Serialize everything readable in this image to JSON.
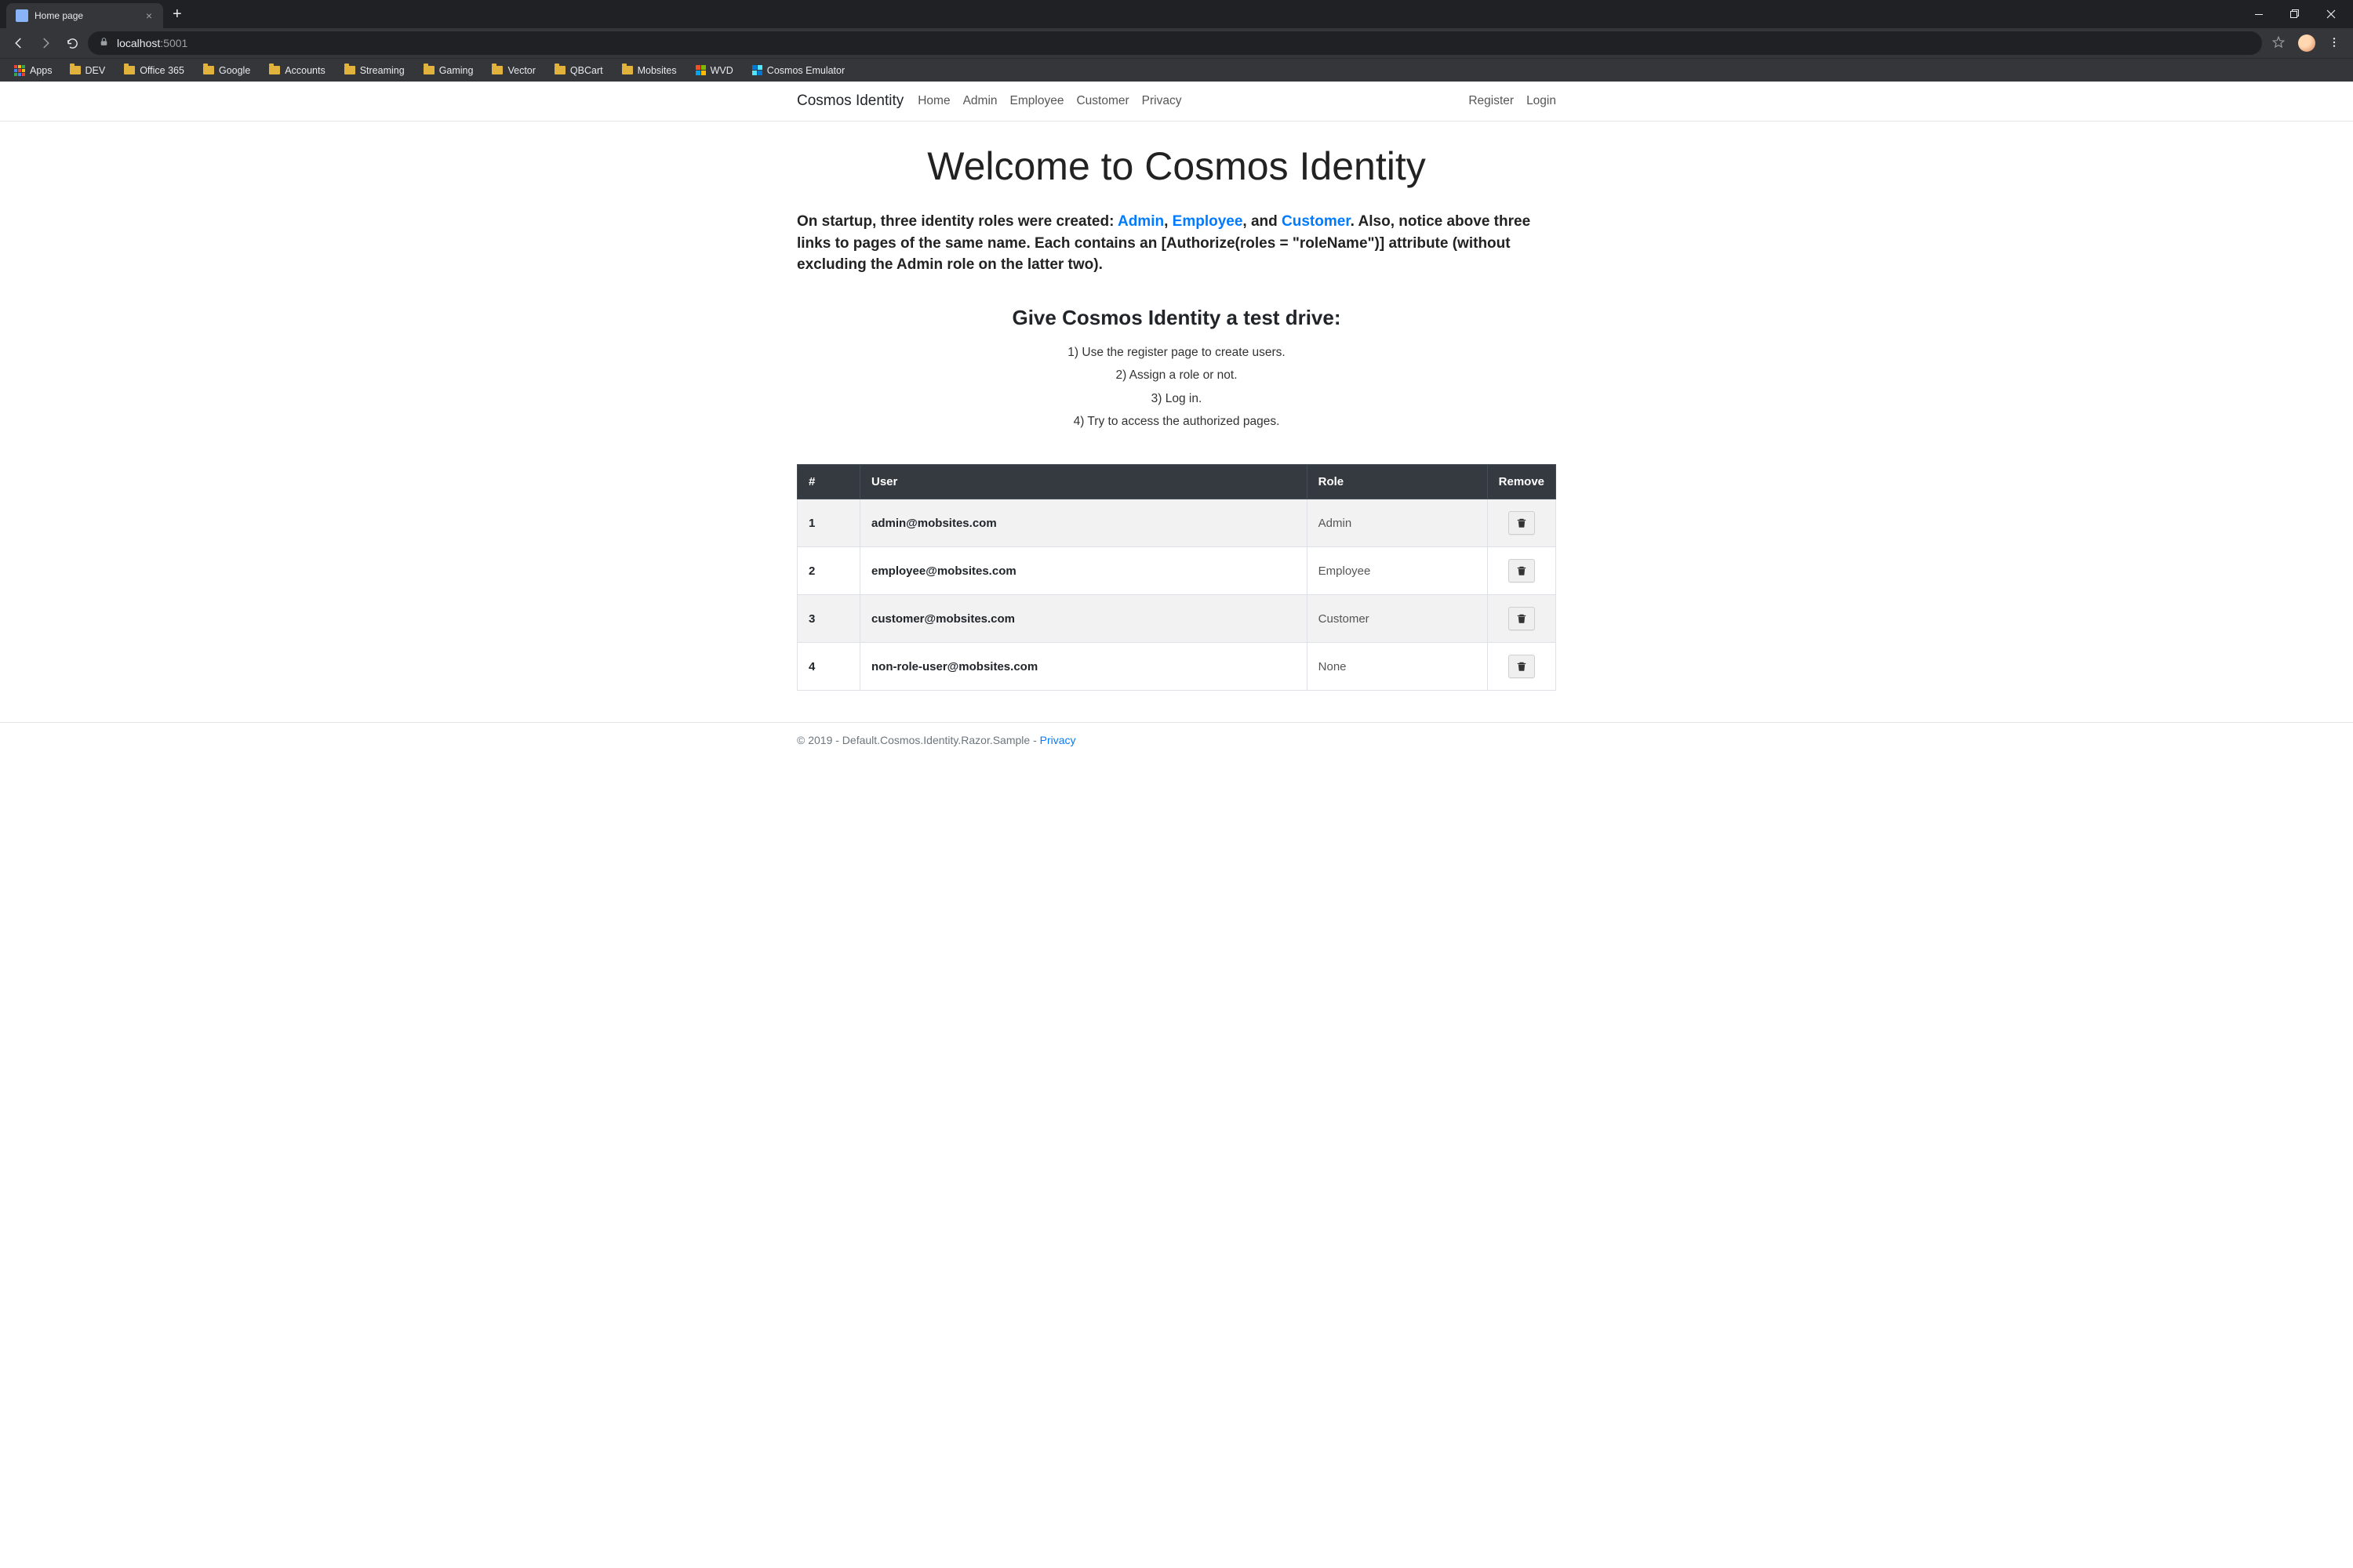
{
  "browser": {
    "tab_title": "Home page",
    "address_host": "localhost",
    "address_port": ":5001",
    "apps_label": "Apps",
    "bookmarks": [
      {
        "label": "DEV",
        "icon": "folder-accent"
      },
      {
        "label": "Office 365",
        "icon": "folder-accent"
      },
      {
        "label": "Google",
        "icon": "folder-accent"
      },
      {
        "label": "Accounts",
        "icon": "folder-accent"
      },
      {
        "label": "Streaming",
        "icon": "folder-accent"
      },
      {
        "label": "Gaming",
        "icon": "folder-accent"
      },
      {
        "label": "Vector",
        "icon": "folder-accent"
      },
      {
        "label": "QBCart",
        "icon": "folder-accent"
      },
      {
        "label": "Mobsites",
        "icon": "folder-accent"
      },
      {
        "label": "WVD",
        "icon": "ms-logo"
      },
      {
        "label": "Cosmos Emulator",
        "icon": "cosmos-logo"
      }
    ]
  },
  "nav": {
    "brand": "Cosmos Identity",
    "links": [
      "Home",
      "Admin",
      "Employee",
      "Customer",
      "Privacy"
    ],
    "right_links": [
      "Register",
      "Login"
    ]
  },
  "page": {
    "title": "Welcome to Cosmos Identity",
    "lead_pre": "On startup, three identity roles were created: ",
    "lead_roles": [
      "Admin",
      "Employee",
      "Customer"
    ],
    "lead_sep1": ", ",
    "lead_sep2": ", and ",
    "lead_post": ". Also, notice above three links to pages of the same name. Each contains an [Authorize(roles = \"roleName\")] attribute (without excluding the Admin role on the latter two).",
    "subhead": "Give Cosmos Identity a test drive:",
    "steps": [
      "1) Use the register page to create users.",
      "2) Assign a role or not.",
      "3) Log in.",
      "4) Try to access the authorized pages."
    ]
  },
  "table": {
    "headers": [
      "#",
      "User",
      "Role",
      "Remove"
    ],
    "rows": [
      {
        "idx": "1",
        "user": "admin@mobsites.com",
        "role": "Admin"
      },
      {
        "idx": "2",
        "user": "employee@mobsites.com",
        "role": "Employee"
      },
      {
        "idx": "3",
        "user": "customer@mobsites.com",
        "role": "Customer"
      },
      {
        "idx": "4",
        "user": "non-role-user@mobsites.com",
        "role": "None"
      }
    ]
  },
  "footer": {
    "text": "© 2019 - Default.Cosmos.Identity.Razor.Sample - ",
    "link": "Privacy"
  }
}
